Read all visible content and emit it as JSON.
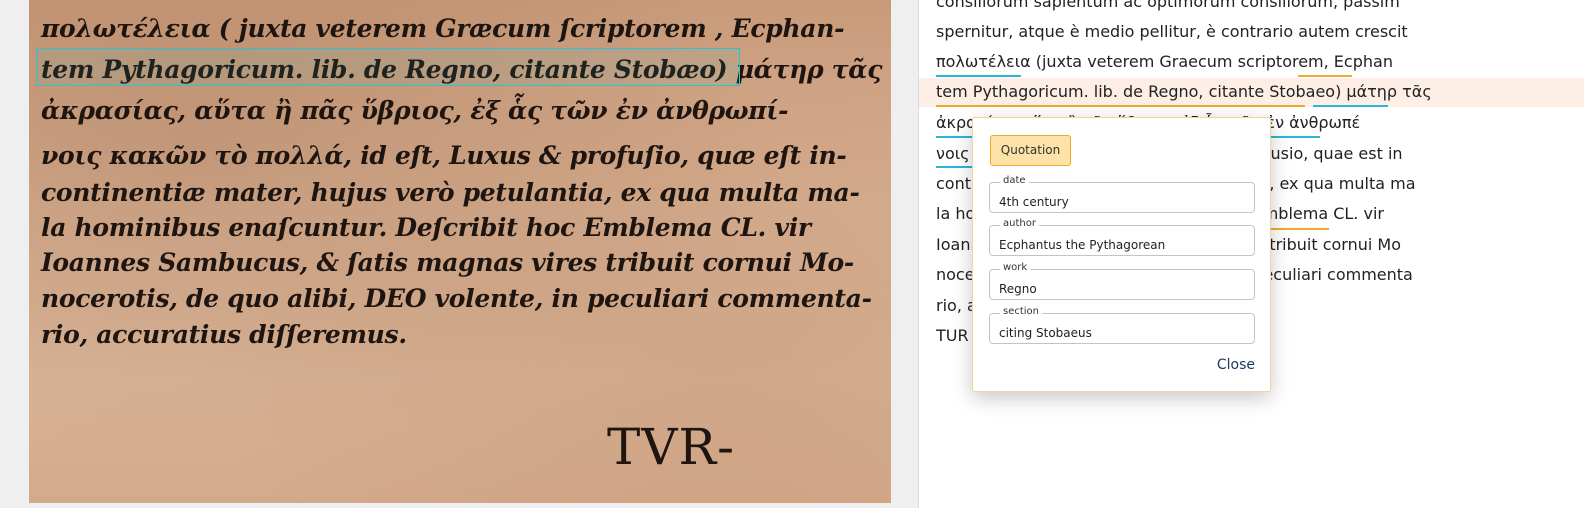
{
  "scan": {
    "lines": [
      "πολωτέλεια ( juxta veterem Græcum ſcriptorem , Ecphan-",
      "tem Pythagoricum. lib. de Regno, citante Stobæo) μάτηρ τᾶς",
      "ἀκρασίας, αὕτα ἢ πᾶς ὕβριος, ἐξ ἇς τῶν ἐν ἀνθρωπί-",
      "νοις κακῶν τὸ πολλά,   id eſt, Luxus & profuſio, quæ eſt in-",
      "continentiæ mater, hujus verò petulantia, ex qua multa ma-",
      "la hominibus enaſcuntur.  Deſcribit hoc Emblema CL.  vir",
      "Ioannes Sambucus, & ſatis magnas vires tribuit cornui Mo-",
      "nocerotis, de quo alibi, DEO volente, in peculiari commenta-",
      "rio, accuratius diſſeremus."
    ],
    "catchword": "TVR-"
  },
  "transcription": {
    "lines": [
      "consiliorum sapientum ac optimorum consiliorum, passim",
      "spernitur, atque è medio pellitur, è contrario autem crescit",
      "πολωτέλεια (juxta veterem Graecum scriptorem, Ecphan",
      "tem Pythagoricum. lib. de Regno, citante Stobaeo) μάτηρ τᾶς",
      "ἀκρασίας, αὕτα ἢ πᾶς ὕβριος, ἐξ ἇς τῶν ἐν ἀνθρωπέ",
      "νοις κακῶν τὸ πολλά, id est, Luxus & profusio, quae est in",
      "continentiae mater, hujus verò petulantia, ex qua multa ma",
      "la hominibus enascuntur. Describit hoc Emblema CL. vir",
      "Ioannes Sambucus, & satis magnas vires tribuit cornui Mo",
      "nocerotis, de quo alibi, DEO volente, in peculiari commenta",
      "rio, accuratius differemus.",
      "TUR"
    ]
  },
  "dialog": {
    "tag_label": "Quotation",
    "fields": [
      {
        "label": "date",
        "value": "4th century"
      },
      {
        "label": "author",
        "value": "Ecphantus the Pythagorean"
      },
      {
        "label": "work",
        "value": "Regno"
      },
      {
        "label": "section",
        "value": "citing Stobaeus"
      }
    ],
    "close_label": "Close"
  },
  "colors": {
    "cyan_annotation": "#29b6d8",
    "orange_annotation": "#f0a830",
    "row_highlight": "#fdeee6"
  }
}
